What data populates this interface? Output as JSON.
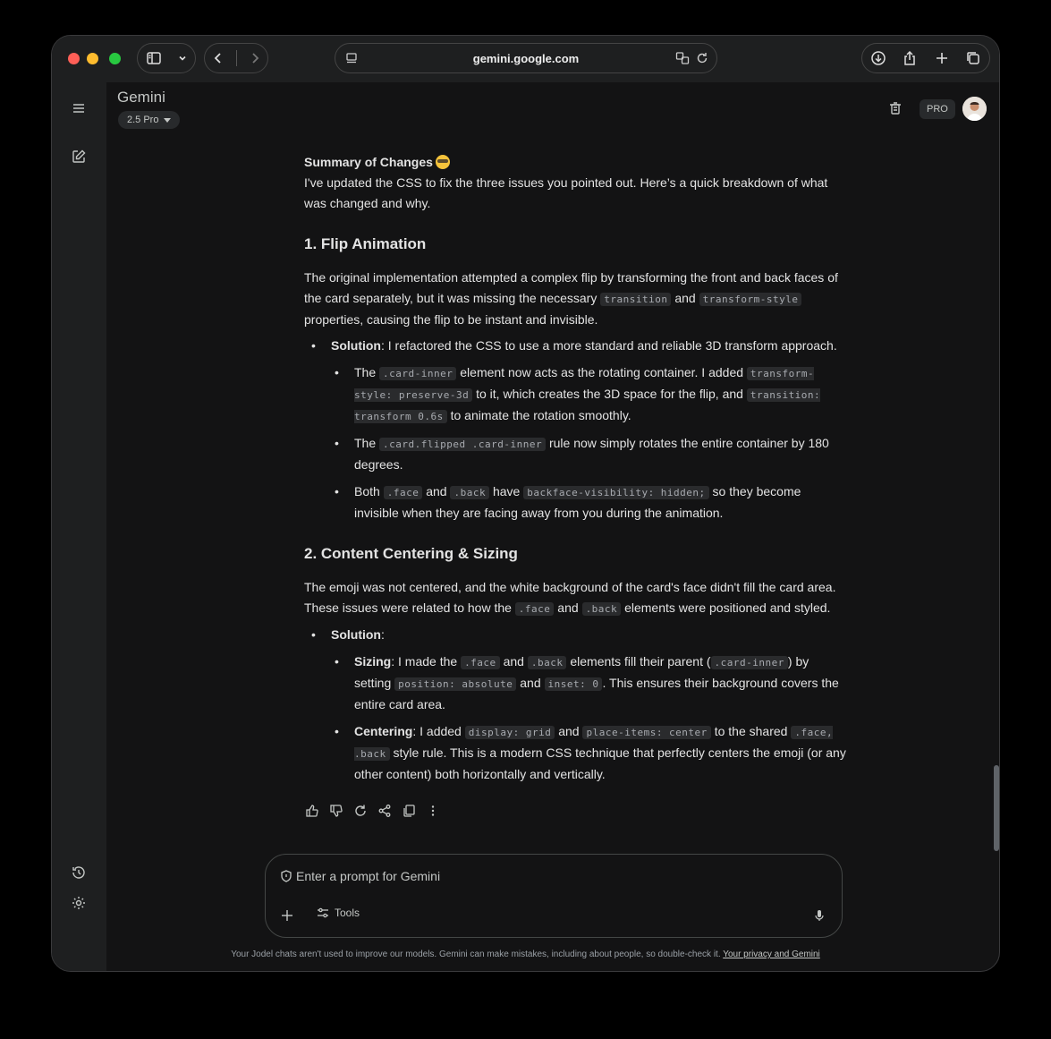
{
  "browser": {
    "url": "gemini.google.com",
    "icons": [
      "sidebar-icon",
      "chevron-down-icon",
      "back-icon",
      "forward-icon",
      "site-settings-icon",
      "translate-icon",
      "reload-icon",
      "download-icon",
      "share-icon",
      "new-tab-icon",
      "tabs-overview-icon"
    ]
  },
  "header": {
    "app_title": "Gemini",
    "model": "2.5 Pro",
    "pro_badge": "PRO"
  },
  "content": {
    "summary_title": "Summary of Changes",
    "intro": "I've updated the CSS to fix the three issues you pointed out. Here’s a quick breakdown of what was changed and why.",
    "section1": {
      "heading": "1. Flip Animation",
      "para_a": "The original implementation attempted a complex flip by transforming the front and back faces of the card separately, but it was missing the necessary ",
      "code_a": "transition",
      "and": " and ",
      "code_b": "transform-style",
      "para_b": " properties, causing the flip to be instant and invisible.",
      "solution_label": "Solution",
      "solution_text": ": I refactored the CSS to use a more standard and reliable 3D transform approach.",
      "b1_the": "The ",
      "b1_code1": ".card-inner",
      "b1_text1": " element now acts as the rotating container. I added ",
      "b1_code2": "transform-style: preserve-3d",
      "b1_text2": " to it, which creates the 3D space for the flip, and ",
      "b1_code3": "transition: transform 0.6s",
      "b1_text3": " to animate the rotation smoothly.",
      "b2_the": "The ",
      "b2_code1": ".card.flipped .card-inner",
      "b2_text1": " rule now simply rotates the entire container by 180 degrees.",
      "b3_both": "Both ",
      "b3_code1": ".face",
      "b3_and": " and ",
      "b3_code2": ".back",
      "b3_have": " have ",
      "b3_code3": "backface-visibility: hidden;",
      "b3_text": " so they become invisible when they are facing away from you during the animation."
    },
    "section2": {
      "heading": "2. Content Centering & Sizing",
      "para_a": "The emoji was not centered, and the white background of the card's face didn't fill the card area. These issues were related to how the ",
      "code_a": ".face",
      "and": " and ",
      "code_b": ".back",
      "para_b": " elements were positioned and styled.",
      "solution_label": "Solution",
      "solution_colon": ":",
      "s_label": "Sizing",
      "s_text1": ": I made the ",
      "s_code1": ".face",
      "s_and": " and ",
      "s_code2": ".back",
      "s_text2": " elements fill their parent (",
      "s_code3": ".card-inner",
      "s_text3": ") by setting ",
      "s_code4": "position: absolute",
      "s_and2": " and ",
      "s_code5": "inset: 0",
      "s_text4": ". This ensures their background covers the entire card area.",
      "c_label": "Centering",
      "c_text1": ": I added ",
      "c_code1": "display: grid",
      "c_and": " and ",
      "c_code2": "place-items: center",
      "c_text2": " to the shared ",
      "c_code3": ".face, .back",
      "c_text3": " style rule. This is a modern CSS technique that perfectly centers the emoji (or any other content) both horizontally and vertically."
    },
    "feedback_icons": [
      "thumbs-up-icon",
      "thumbs-down-icon",
      "regenerate-icon",
      "share-icon",
      "copy-icon",
      "more-icon"
    ]
  },
  "input": {
    "placeholder": "Enter a prompt for Gemini",
    "tools_label": "Tools"
  },
  "footer": {
    "disclaimer": "Your Jodel chats aren't used to improve our models. Gemini can make mistakes, including about people, so double-check it. ",
    "privacy_link": "Your privacy and Gemini"
  }
}
